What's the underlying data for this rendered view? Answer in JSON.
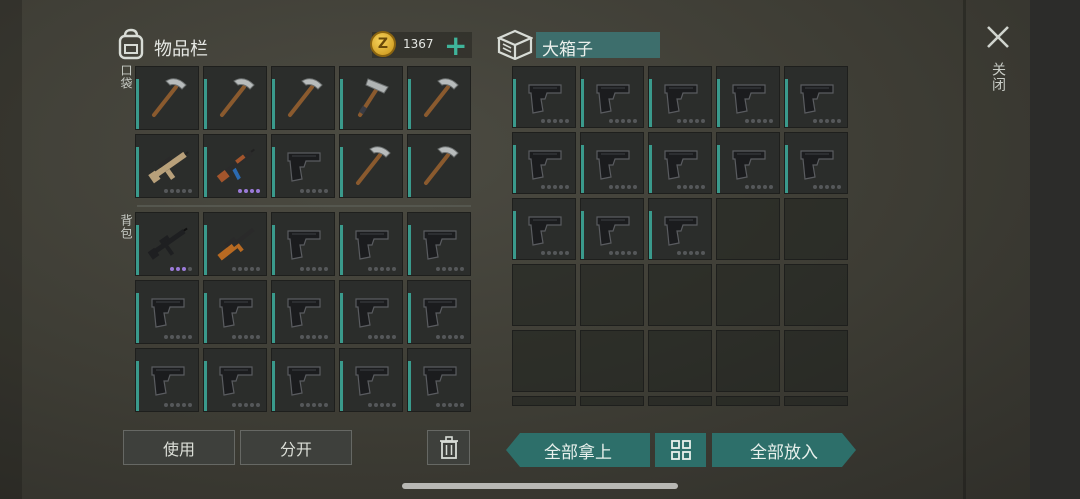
{
  "inventory": {
    "title": "物品栏",
    "money": "1367",
    "coin_letter": "Z",
    "pocket_label": "口袋",
    "backpack_label": "背包"
  },
  "box": {
    "title": "大箱子"
  },
  "close_label": "关闭",
  "buttons": {
    "use": "使用",
    "split": "分开",
    "take_all": "全部拿上",
    "put_all": "全部放入"
  },
  "pocket_items": [
    {
      "icon": "pickaxe-icon",
      "dots": 0
    },
    {
      "icon": "pickaxe-icon",
      "dots": 0
    },
    {
      "icon": "pickaxe-icon",
      "dots": 0
    },
    {
      "icon": "hammer-icon",
      "dots": 0
    },
    {
      "icon": "pickaxe-icon",
      "dots": 0
    },
    {
      "icon": "rifle-scar-icon",
      "dots": 5,
      "dots_on": 0
    },
    {
      "icon": "ak-rifle-icon",
      "dots": 4,
      "dots_on": 4
    },
    {
      "icon": "pistol-icon",
      "dots": 5,
      "dots_on": 0
    },
    {
      "icon": "pickaxe-icon",
      "dots": 0
    },
    {
      "icon": "pickaxe-icon",
      "dots": 0
    }
  ],
  "backpack_items": [
    {
      "icon": "m4-rifle-icon",
      "dots": 4,
      "dots_on": 3
    },
    {
      "icon": "sniper-rifle-icon",
      "dots": 5,
      "dots_on": 0
    },
    {
      "icon": "pistol-icon",
      "dots": 5
    },
    {
      "icon": "pistol-icon",
      "dots": 5
    },
    {
      "icon": "pistol-icon",
      "dots": 5
    },
    {
      "icon": "pistol-icon",
      "dots": 5
    },
    {
      "icon": "pistol-icon",
      "dots": 5
    },
    {
      "icon": "pistol-icon",
      "dots": 5
    },
    {
      "icon": "pistol-icon",
      "dots": 5
    },
    {
      "icon": "pistol-icon",
      "dots": 5
    },
    {
      "icon": "pistol-icon",
      "dots": 5
    },
    {
      "icon": "pistol-icon",
      "dots": 5
    },
    {
      "icon": "pistol-icon",
      "dots": 5
    },
    {
      "icon": "pistol-icon",
      "dots": 5
    },
    {
      "icon": "pistol-icon",
      "dots": 5
    }
  ],
  "box_items": [
    "pistol-icon",
    "pistol-icon",
    "pistol-icon",
    "pistol-icon",
    "pistol-icon",
    "pistol-icon",
    "pistol-icon",
    "pistol-icon",
    "pistol-icon",
    "pistol-icon",
    "pistol-icon",
    "pistol-icon",
    "pistol-icon",
    "",
    "",
    "",
    "",
    "",
    "",
    "",
    "",
    "",
    "",
    "",
    "",
    "",
    "",
    "",
    "",
    ""
  ],
  "colors": {
    "accent": "#2d6f6a",
    "stripe": "#3a9a8c",
    "coin": "#e0b232"
  }
}
